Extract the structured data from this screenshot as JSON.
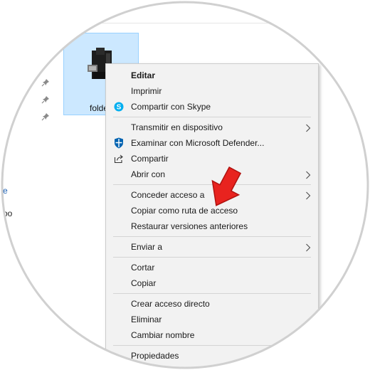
{
  "explorer": {
    "file_label": "folder",
    "left_texts": [
      "e",
      "oo"
    ]
  },
  "context_menu": {
    "groups": [
      {
        "items": [
          {
            "label": "Editar",
            "bold": true,
            "icon": "none",
            "submenu": false
          },
          {
            "label": "Imprimir",
            "bold": false,
            "icon": "none",
            "submenu": false
          },
          {
            "label": "Compartir con Skype",
            "bold": false,
            "icon": "skype-icon",
            "submenu": false
          }
        ]
      },
      {
        "items": [
          {
            "label": "Transmitir en dispositivo",
            "bold": false,
            "icon": "none",
            "submenu": true
          },
          {
            "label": "Examinar con Microsoft Defender...",
            "bold": false,
            "icon": "defender-shield-icon",
            "submenu": false
          },
          {
            "label": "Compartir",
            "bold": false,
            "icon": "share-icon",
            "submenu": false
          },
          {
            "label": "Abrir con",
            "bold": false,
            "icon": "none",
            "submenu": true
          }
        ]
      },
      {
        "items": [
          {
            "label": "Conceder acceso a",
            "bold": false,
            "icon": "none",
            "submenu": true
          },
          {
            "label": "Copiar como ruta de acceso",
            "bold": false,
            "icon": "none",
            "submenu": false
          },
          {
            "label": "Restaurar versiones anteriores",
            "bold": false,
            "icon": "none",
            "submenu": false
          }
        ]
      },
      {
        "items": [
          {
            "label": "Enviar a",
            "bold": false,
            "icon": "none",
            "submenu": true
          }
        ]
      },
      {
        "items": [
          {
            "label": "Cortar",
            "bold": false,
            "icon": "none",
            "submenu": false
          },
          {
            "label": "Copiar",
            "bold": false,
            "icon": "none",
            "submenu": false
          }
        ]
      },
      {
        "items": [
          {
            "label": "Crear acceso directo",
            "bold": false,
            "icon": "none",
            "submenu": false
          },
          {
            "label": "Eliminar",
            "bold": false,
            "icon": "none",
            "submenu": false
          },
          {
            "label": "Cambiar nombre",
            "bold": false,
            "icon": "none",
            "submenu": false
          }
        ]
      },
      {
        "items": [
          {
            "label": "Propiedades",
            "bold": false,
            "icon": "none",
            "submenu": false
          }
        ]
      }
    ]
  },
  "colors": {
    "selection_fill": "#cce8ff",
    "menu_background": "#f2f2f2",
    "annotation_arrow": "#e8231f",
    "skype_blue": "#00aff0",
    "defender_blue": "#0063b1"
  }
}
